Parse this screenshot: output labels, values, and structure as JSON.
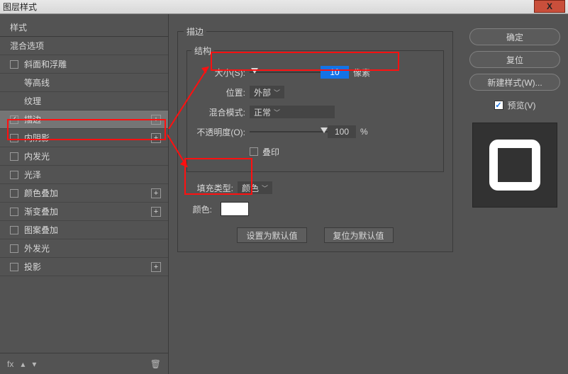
{
  "window": {
    "title": "图层样式",
    "close": "X"
  },
  "left": {
    "head": "样式",
    "blend": "混合选项",
    "items": [
      {
        "label": "斜面和浮雕",
        "indent": false,
        "plus": false,
        "checked": false,
        "selected": false
      },
      {
        "label": "等高线",
        "indent": true,
        "plus": false,
        "checked": false,
        "selected": false
      },
      {
        "label": "纹理",
        "indent": true,
        "plus": false,
        "checked": false,
        "selected": false
      },
      {
        "label": "描边",
        "indent": false,
        "plus": true,
        "checked": true,
        "selected": true
      },
      {
        "label": "内阴影",
        "indent": false,
        "plus": true,
        "checked": false,
        "selected": false
      },
      {
        "label": "内发光",
        "indent": false,
        "plus": false,
        "checked": false,
        "selected": false
      },
      {
        "label": "光泽",
        "indent": false,
        "plus": false,
        "checked": false,
        "selected": false
      },
      {
        "label": "颜色叠加",
        "indent": false,
        "plus": true,
        "checked": false,
        "selected": false
      },
      {
        "label": "渐变叠加",
        "indent": false,
        "plus": true,
        "checked": false,
        "selected": false
      },
      {
        "label": "图案叠加",
        "indent": false,
        "plus": false,
        "checked": false,
        "selected": false
      },
      {
        "label": "外发光",
        "indent": false,
        "plus": false,
        "checked": false,
        "selected": false
      },
      {
        "label": "投影",
        "indent": false,
        "plus": true,
        "checked": false,
        "selected": false
      }
    ],
    "foot_fx": "fx"
  },
  "center": {
    "panel_title": "描边",
    "structure_title": "结构",
    "size_label": "大小(S):",
    "size_value": "10",
    "size_unit": "像素",
    "position_label": "位置:",
    "position_value": "外部",
    "blend_label": "混合模式:",
    "blend_value": "正常",
    "opacity_label": "不透明度(O):",
    "opacity_value": "100",
    "opacity_unit": "%",
    "overprint": "叠印",
    "filltype_label": "填充类型:",
    "filltype_value": "颜色",
    "color_label": "颜色:",
    "make_default": "设置为默认值",
    "reset_default": "复位为默认值"
  },
  "right": {
    "ok": "确定",
    "cancel": "复位",
    "newstyle": "新建样式(W)...",
    "preview": "预览(V)"
  }
}
